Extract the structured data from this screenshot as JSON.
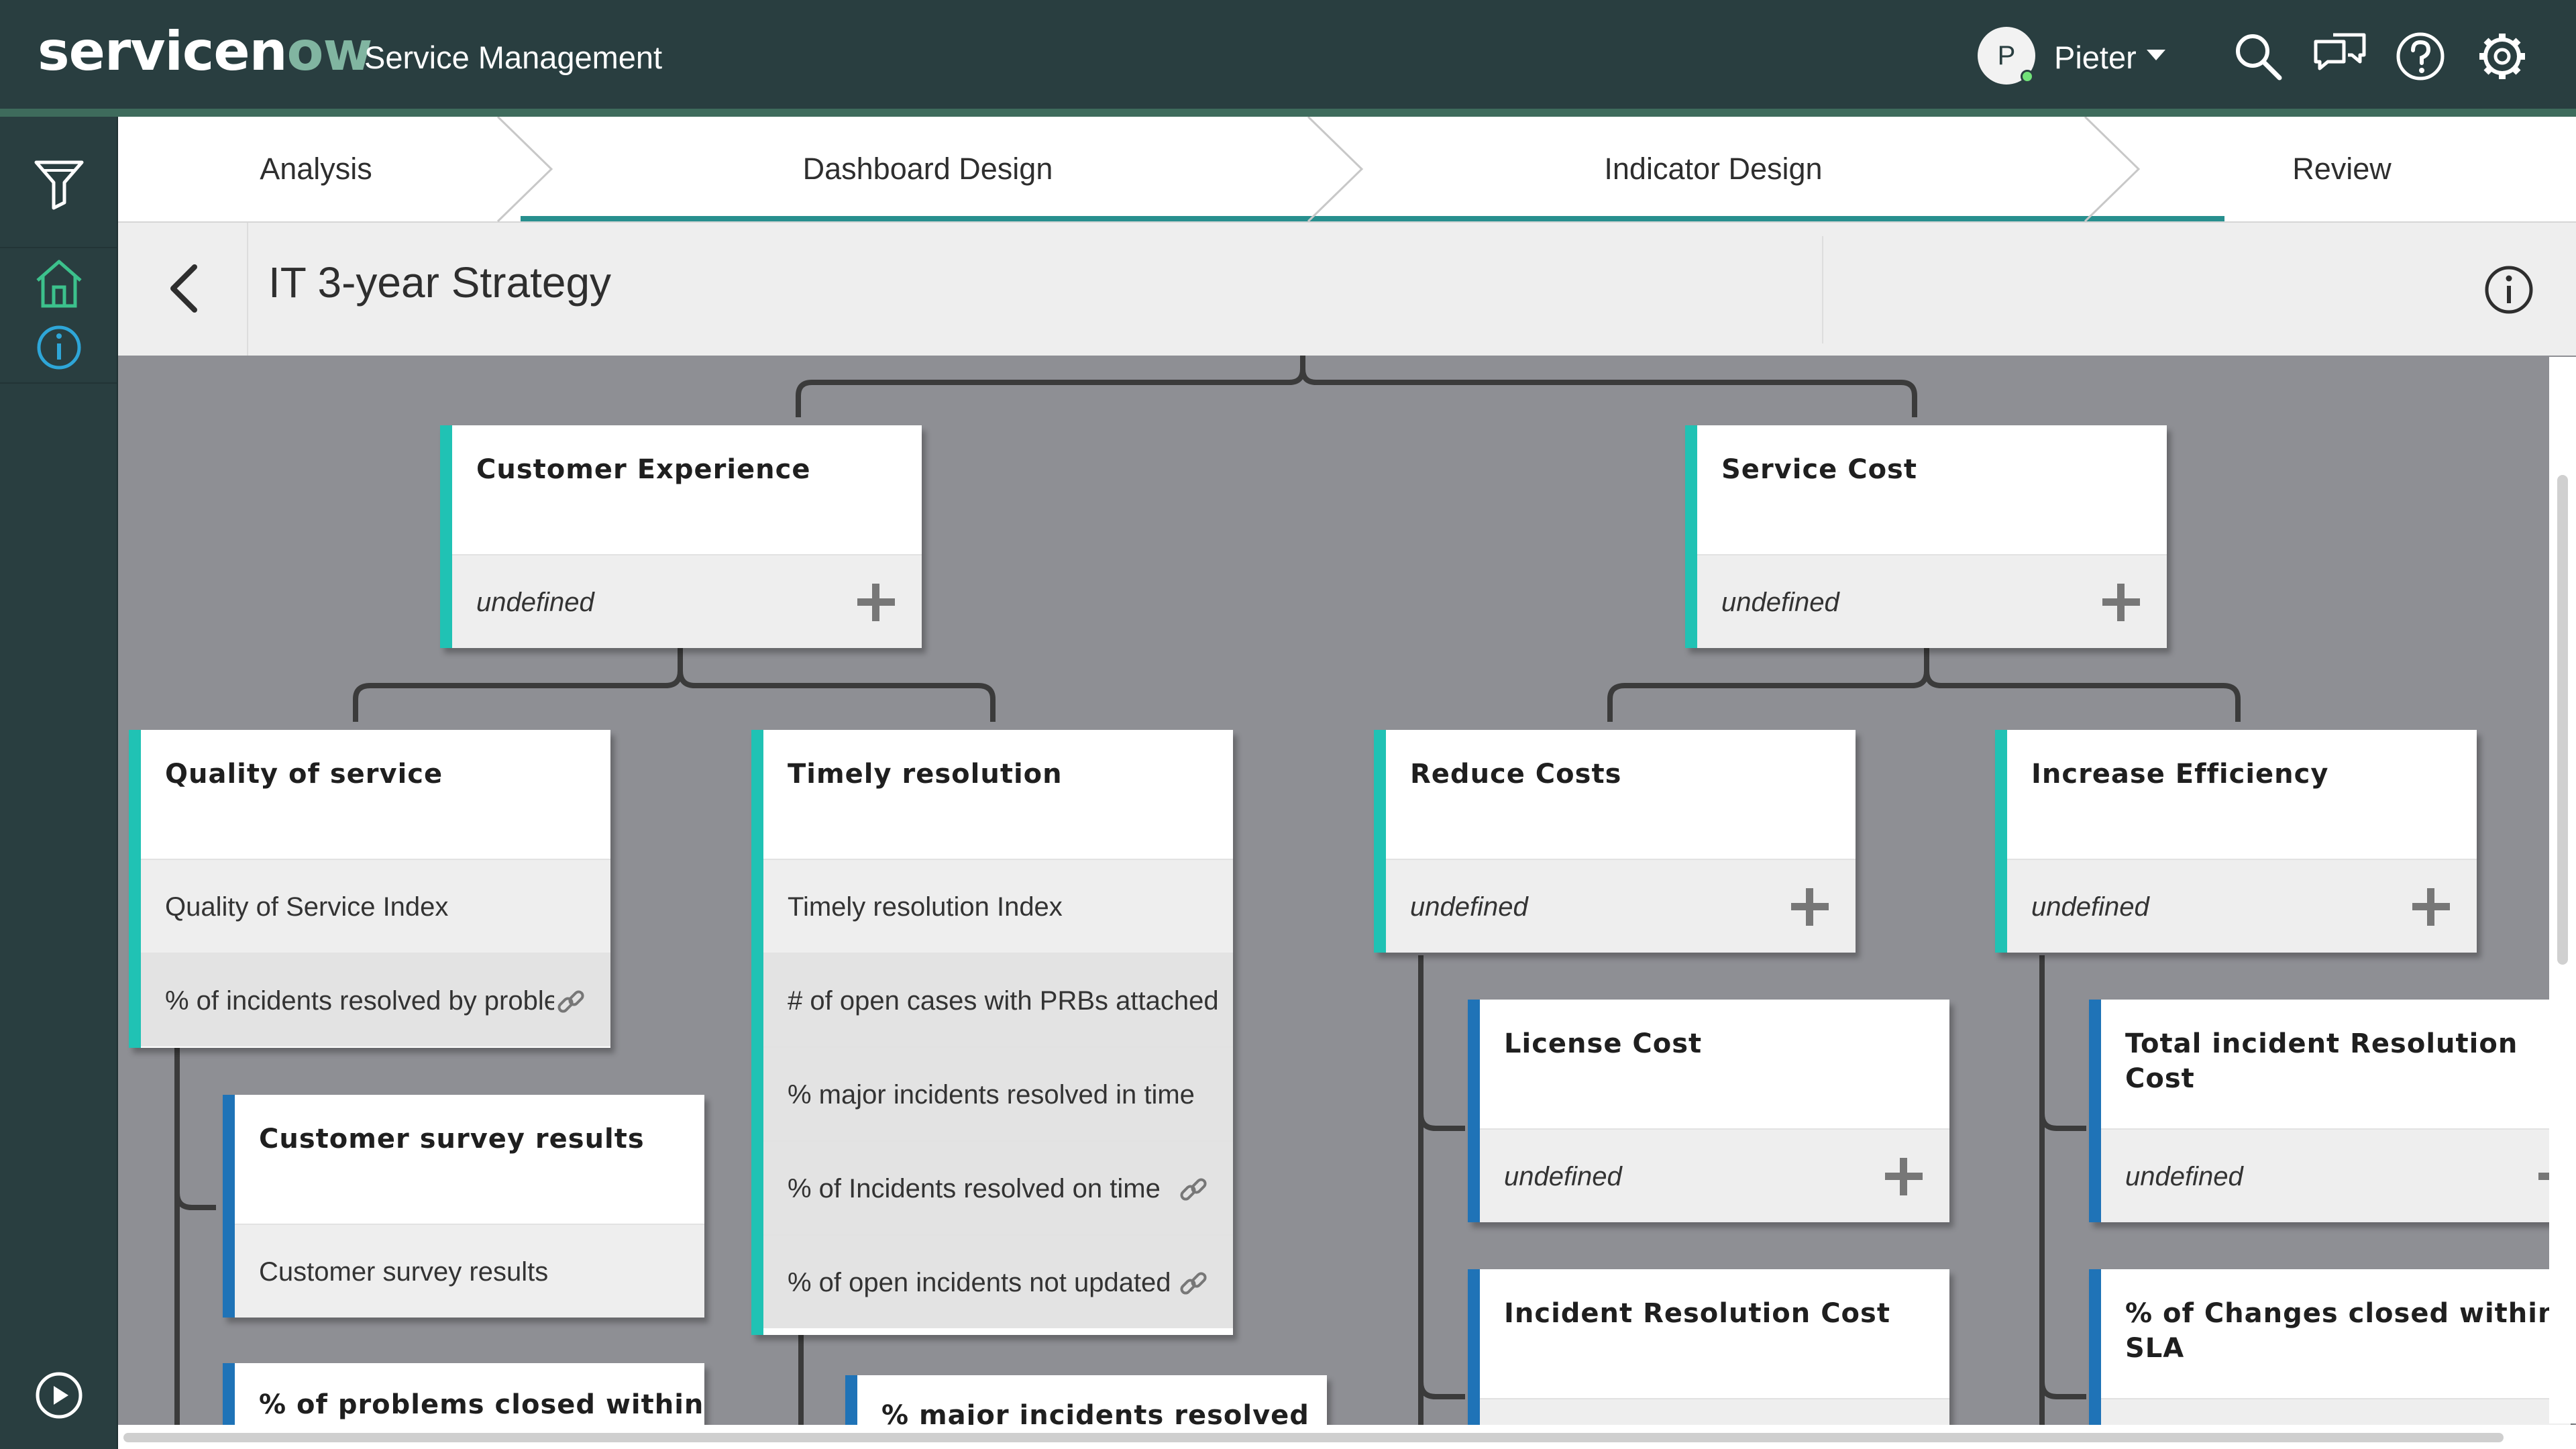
{
  "header": {
    "logo_text_a": "servicen",
    "logo_text_b": "ow",
    "logo_text_c": "",
    "app_name": "Service Management",
    "user_initial": "P",
    "user_name": "Pieter",
    "icons": [
      "search-icon",
      "chat-icon",
      "help-icon",
      "gear-icon"
    ]
  },
  "rail": {
    "icons": [
      "filter-icon",
      "home-icon",
      "info-icon",
      "play-icon"
    ]
  },
  "steps": [
    {
      "label": "Analysis"
    },
    {
      "label": "Dashboard Design"
    },
    {
      "label": "Indicator Design"
    },
    {
      "label": "Review"
    }
  ],
  "page": {
    "title": "IT 3-year Strategy"
  },
  "nodes": {
    "customer_experience": {
      "title": "Customer Experience",
      "value": "undefined"
    },
    "service_cost": {
      "title": "Service Cost",
      "value": "undefined"
    },
    "quality_of_service": {
      "title": "Quality of service",
      "rows": [
        "Quality of Service Index",
        "% of incidents resolved by proble"
      ]
    },
    "timely_resolution": {
      "title": "Timely resolution",
      "rows": [
        "Timely resolution Index",
        "# of open cases with PRBs attached",
        "% major incidents resolved in time",
        "% of Incidents resolved on time",
        "% of open incidents not updated"
      ]
    },
    "reduce_costs": {
      "title": "Reduce Costs",
      "value": "undefined"
    },
    "increase_efficiency": {
      "title": "Increase Efficiency",
      "value": "undefined"
    },
    "customer_survey": {
      "title": "Customer survey results",
      "rows": [
        "Customer survey results"
      ]
    },
    "problems_closed": {
      "title": "% of problems closed within"
    },
    "major_incidents": {
      "title": "% major incidents resolved"
    },
    "license_cost": {
      "title": "License Cost",
      "value": "undefined"
    },
    "incident_resolution_cost": {
      "title": "Incident Resolution Cost"
    },
    "total_incident_cost": {
      "title": "Total incident Resolution Cost",
      "value": "undefined"
    },
    "changes_closed": {
      "title": "% of Changes closed within SLA"
    }
  },
  "colors": {
    "header_bg": "#293E40",
    "accent_teal": "#20C2B4",
    "accent_blue": "#1F73B7",
    "step_progress": "#278F8E",
    "canvas_bg": "#8e8f94"
  }
}
